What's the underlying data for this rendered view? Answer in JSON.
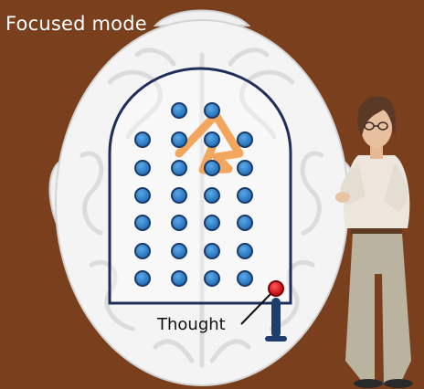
{
  "caption": "Focused mode",
  "thought_label": "Thought",
  "colors": {
    "background": "#7a3f1c",
    "head": "#f4f4f4",
    "brain_lines": "#d8d8d8",
    "board_outline": "#1f2f5a",
    "peg_fill": "#2e7fc7",
    "peg_outline": "#1a3a6a",
    "path": "#f2a050",
    "pinball": "#e0101a",
    "flipper": "#1e3e6e"
  },
  "icons": [
    "head-outline",
    "pinball-board",
    "pinball-flipper",
    "presenter"
  ]
}
